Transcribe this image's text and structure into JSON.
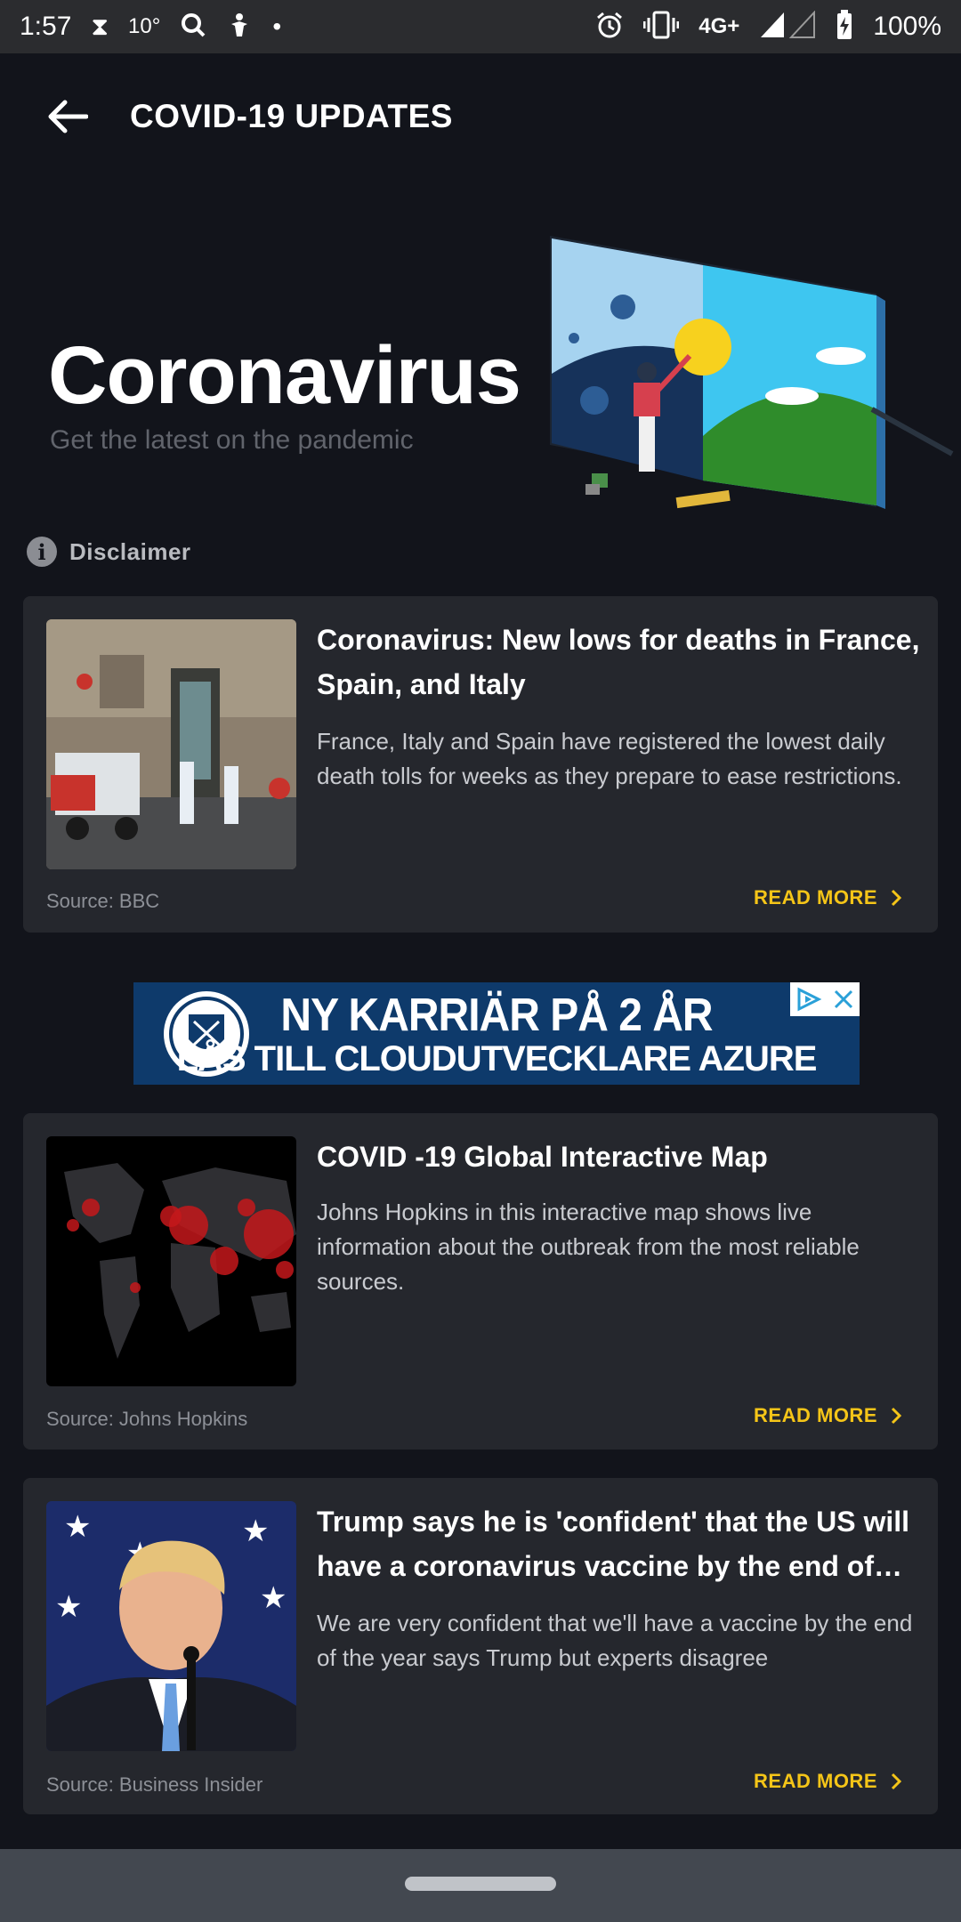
{
  "status_bar": {
    "time": "1:57",
    "temperature": "10°",
    "network": "4G+",
    "battery": "100%"
  },
  "app_bar": {
    "title": "COVID-19 UPDATES"
  },
  "hero": {
    "title": "Coronavirus",
    "subtitle": "Get the latest on the pandemic"
  },
  "disclaimer": {
    "icon": "info-icon",
    "label": "Disclaimer"
  },
  "articles": [
    {
      "title": "Coronavirus: New lows for deaths in France, Spain, and Italy",
      "description": "France, Italy and Spain have registered the lowest daily death tolls for weeks as they prepare to ease restrictions.",
      "source": "Source: BBC",
      "cta": "READ MORE"
    },
    {
      "title": "COVID -19 Global Interactive Map",
      "description": "Johns Hopkins in this interactive map shows live information about the outbreak from the most reliable sources.",
      "source": "Source: Johns Hopkins",
      "cta": "READ MORE"
    },
    {
      "title": "Trump says he is 'confident' that the US will have a coronavirus vaccine by the end of th…",
      "description": "We are very confident that we'll have a vaccine by the end  of the year says Trump but experts disagree",
      "source": "Source: Business Insider",
      "cta": "READ MORE"
    }
  ],
  "ad": {
    "line1": "NY KARRIÄR PÅ 2 ÅR",
    "line2": "LÅS TILL CLOUDUTVECKLARE AZURE"
  },
  "colors": {
    "background": "#12141b",
    "card": "#25272d",
    "accent": "#f5c518",
    "status_bar": "#2b2c2f",
    "nav_bar": "#434850"
  }
}
